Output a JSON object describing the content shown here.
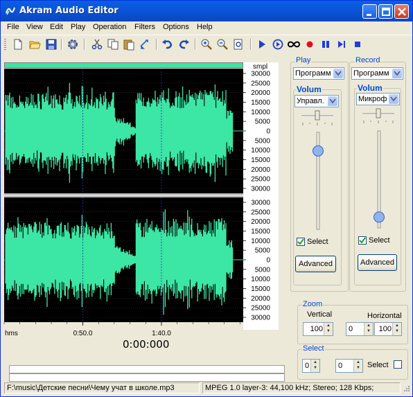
{
  "window": {
    "title": "Akram Audio Editor"
  },
  "menu": [
    "File",
    "View",
    "Edit",
    "Play",
    "Operation",
    "Filters",
    "Options",
    "Help"
  ],
  "toolbar": {
    "icons": [
      "new-file-icon",
      "open-folder-icon",
      "save-icon",
      "settings-icon",
      "cut-icon",
      "copy-icon",
      "paste-icon",
      "crop-icon",
      "undo-icon",
      "redo-icon",
      "zoom-in-icon",
      "zoom-out-icon",
      "zoom-fit-icon",
      "play-icon",
      "play-loop-icon",
      "loop-icon",
      "record-icon",
      "pause-icon",
      "play-to-end-icon",
      "stop-icon"
    ]
  },
  "waveform": {
    "unit_label": "smpl",
    "amplitude_ticks": [
      "30000",
      "25000",
      "20000",
      "15000",
      "10000",
      "5000",
      "0",
      "5000",
      "10000",
      "15000",
      "20000",
      "25000",
      "30000"
    ],
    "time_axis_label": "hms",
    "time_ticks": [
      "0:50.0",
      "1:40.0"
    ],
    "time_tick_seconds": [
      50,
      100
    ],
    "total_seconds": 152,
    "wave_color": "#3ce6a4",
    "background_color": "#000000"
  },
  "position_readout": "0:00:000",
  "play": {
    "group_label": "Play",
    "device_value": "Программ",
    "volume_label": "Volum",
    "control_value": "Управл.",
    "volume_level": 0.85,
    "select_label": "Select",
    "select_checked": true,
    "advanced_label": "Advanced"
  },
  "record": {
    "group_label": "Record",
    "device_value": "Программ",
    "volume_label": "Volum",
    "control_value": "Микроф",
    "volume_level": 0.07,
    "select_label": "Select",
    "select_checked": true,
    "advanced_label": "Advanced"
  },
  "zoom": {
    "group_label": "Zoom",
    "vertical_label": "Vertical",
    "horizontal_label": "Horizontal",
    "vertical_value": "100",
    "horizontal_offset": "0",
    "horizontal_value": "100"
  },
  "select": {
    "group_label": "Select",
    "start_value": "0",
    "end_value": "0",
    "check_label": "Select",
    "checked": false
  },
  "status": {
    "file_path": "F:\\music\\Детские песни\\Чему учат в школе.mp3",
    "format_info": "MPEG 1.0 layer-3: 44,100 kHz; Stereo; 128 Kbps;"
  },
  "colors": {
    "accent": "#0046d5",
    "titlebar": "#0b55d8",
    "wave": "#3ce6a4"
  }
}
